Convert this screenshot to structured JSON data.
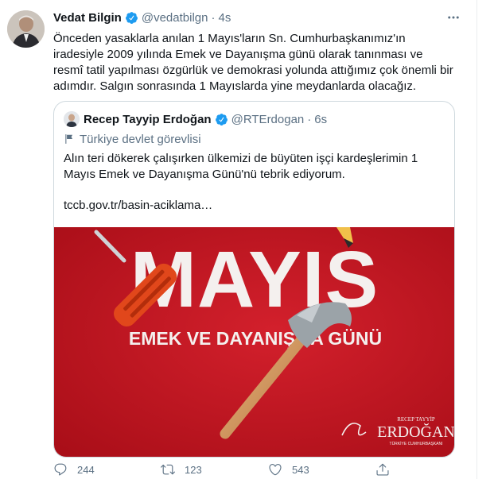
{
  "tweet": {
    "author_name": "Vedat Bilgin",
    "author_handle": "@vedatbilgn",
    "separator": "·",
    "time": "4s",
    "text": "Önceden yasaklarla anılan 1 Mayıs'ların Sn. Cumhurbaşkanımız'ın iradesiyle 2009 yılında Emek ve Dayanışma günü olarak tanınması ve resmî tatil yapılması özgürlük ve demokrasi yolunda attığımız çok önemli bir adımdır. Salgın sonrasında 1 Mayıslarda yine meydanlarda olacağız.",
    "avatar_icon": "person-portrait-icon",
    "more_icon": "more-horizontal-icon"
  },
  "quoted": {
    "author_name": "Recep Tayyip Erdoğan",
    "author_handle": "@RTErdogan",
    "separator": "·",
    "time": "6s",
    "label": "Türkiye devlet görevlisi",
    "text": "Alın teri dökerek çalışırken ülkemizi de büyüten işçi kardeşlerimin 1 Mayıs Emek ve Dayanışma Günü'nü tebrik ediyorum.",
    "link": "tccb.gov.tr/basin-aciklama…",
    "media": {
      "headline": "MAYIS",
      "subline": "EMEK VE DAYANIŞMA GÜNÜ",
      "signature_top": "RECEP TAYYİP",
      "signature_name": "ERDOĞAN",
      "signature_bottom": "TÜRKİYE CUMHURBAŞKANI",
      "background_color": "#c4121f"
    }
  },
  "actions": {
    "reply_count": "244",
    "retweet_count": "123",
    "like_count": "543"
  },
  "colors": {
    "verified": "#1d9bf0",
    "secondary_text": "#5b7083",
    "border": "#cfd9de"
  }
}
